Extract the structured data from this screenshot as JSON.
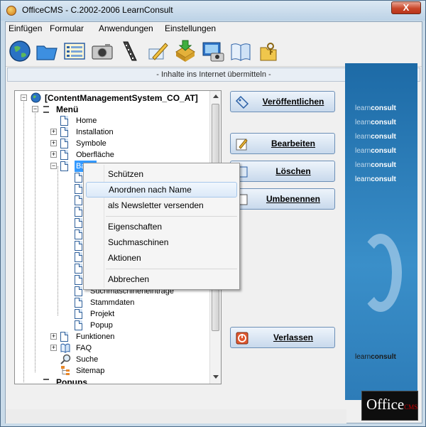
{
  "window": {
    "title": "OfficeCMS - C.2002-2006 LearnConsult",
    "close_symbol": "X"
  },
  "menu": [
    "Einfügen",
    "Formular",
    "Anwendungen",
    "Einstellungen"
  ],
  "toolbar": [
    "globe-icon",
    "folder-icon",
    "list-icon",
    "camera-icon",
    "film-icon",
    "pencil-icon",
    "download-icon",
    "screen-camera-icon",
    "book-icon",
    "key-folder-icon"
  ],
  "infobar": "- Inhalte ins Internet übermitteln -",
  "tree": {
    "root": "[ContentManagementSystem_CO_AT]",
    "menu_label": "Menü",
    "items": [
      "Home",
      "Installation",
      "Symbole",
      "Oberfläche",
      "Basis"
    ],
    "hidden_items": [
      "Suchmaschineneinträge",
      "Stammdaten",
      "Projekt",
      "Popup"
    ],
    "after_items": [
      "Funktionen",
      "FAQ",
      "Suche",
      "Sitemap"
    ],
    "popups_label": "Popups"
  },
  "buttons": {
    "publish": "Veröffentlichen",
    "edit": "Bearbeiten",
    "delete": "Löschen",
    "rename": "Umbenennen",
    "quit": "Verlassen"
  },
  "context_menu": {
    "group1": [
      "Schützen",
      "Anordnen nach Name",
      "als Newsletter versenden"
    ],
    "group2": [
      "Eigenschaften",
      "Suchmaschinen",
      "Aktionen"
    ],
    "group3": [
      "Abbrechen"
    ],
    "highlighted": "Anordnen nach Name"
  },
  "branding": {
    "learnconsult_light": "learn",
    "learnconsult_bold": "consult",
    "office_logo": "Office",
    "office_sub": "CMS"
  }
}
